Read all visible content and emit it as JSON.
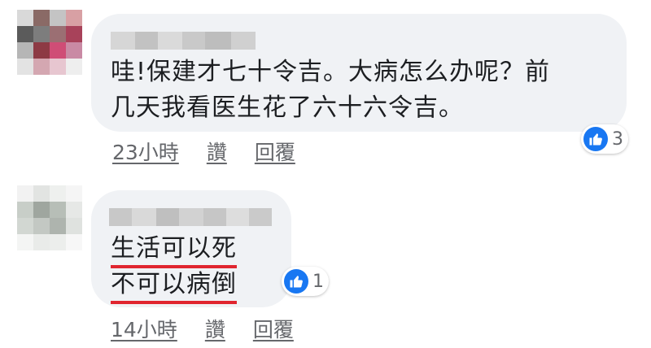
{
  "comments": [
    {
      "text_lines": [
        "哇!保建才七十令吉。大病怎么办呢？前",
        "几天我看医生花了六十六令吉。"
      ],
      "time": "23小時",
      "like_label": "讚",
      "reply_label": "回覆",
      "reaction_count": "3",
      "avatar_colors": [
        "#d9d9d9",
        "#8a6a66",
        "#c4c4c4",
        "#d8a0a4",
        "#5b5b5b",
        "#7d7d7d",
        "#9b6f73",
        "#a8425a",
        "#b6b6b6",
        "#8d3a44",
        "#cf4d76",
        "#c98aa4",
        "#e3e3e3",
        "#d4a7b1",
        "#e7c6d0",
        "#eeeeee"
      ]
    },
    {
      "text_lines": [
        "生活可以死",
        "不可以病倒"
      ],
      "time": "14小時",
      "like_label": "讚",
      "reply_label": "回覆",
      "reaction_count": "1",
      "avatar_colors": [
        "#f2f2f2",
        "#e2e4e2",
        "#eef0ee",
        "#f5f5f5",
        "#c8cec8",
        "#9fa69f",
        "#b7beb7",
        "#e6e8e6",
        "#d2d7d2",
        "#c3c8c3",
        "#aeb4ae",
        "#dfe2df",
        "#f4f5f4",
        "#e9ebe9",
        "#eceeec",
        "#f7f7f7"
      ]
    }
  ],
  "colors": {
    "bubble": "#f0f2f5",
    "text": "#1c1e21",
    "meta": "#65676b",
    "like_blue": "#1877f2",
    "underline_red": "#e0252f"
  }
}
